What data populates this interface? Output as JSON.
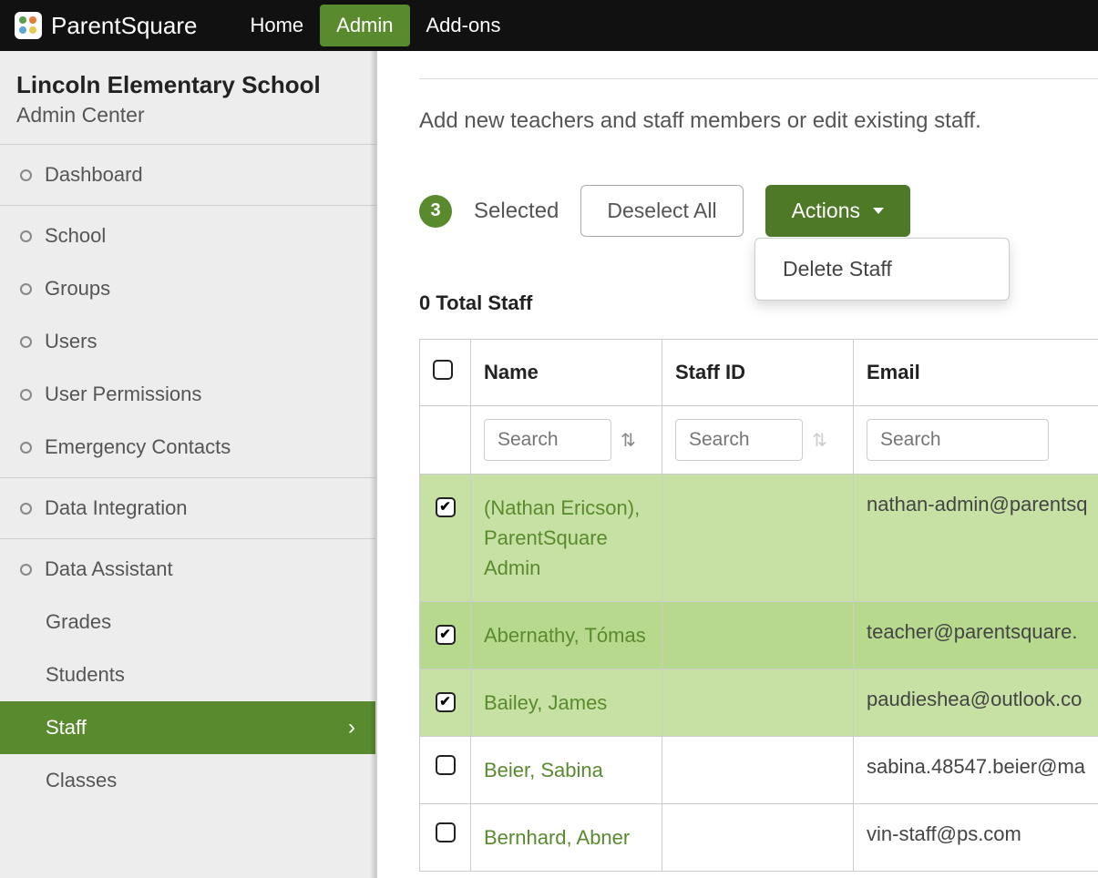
{
  "topnav": {
    "brand": "ParentSquare",
    "items": [
      "Home",
      "Admin",
      "Add-ons"
    ],
    "active_index": 1
  },
  "sidebar": {
    "school_name": "Lincoln Elementary School",
    "subtitle": "Admin Center",
    "section1": [
      "Dashboard"
    ],
    "section2": [
      "School",
      "Groups",
      "Users",
      "User Permissions",
      "Emergency Contacts"
    ],
    "section3": [
      "Data Integration"
    ],
    "section4_header": "Data Assistant",
    "section4_items": [
      "Grades",
      "Students",
      "Staff",
      "Classes"
    ],
    "active_item": "Staff"
  },
  "main": {
    "intro": "Add new teachers and staff members or edit existing staff.",
    "selected_count": "3",
    "selected_label": "Selected",
    "deselect_label": "Deselect All",
    "actions_label": "Actions",
    "actions_menu": [
      "Delete Staff"
    ],
    "total_staff_label": "0 Total Staff"
  },
  "table": {
    "columns": {
      "name": "Name",
      "staff_id": "Staff ID",
      "email": "Email"
    },
    "search_placeholder": "Search",
    "rows": [
      {
        "checked": true,
        "name": "(Nathan Ericson), ParentSquare Admin",
        "staff_id": "",
        "email": "nathan-admin@parentsq"
      },
      {
        "checked": true,
        "name": "Abernathy, Tómas",
        "staff_id": "",
        "email": "teacher@parentsquare."
      },
      {
        "checked": true,
        "name": "Bailey, James",
        "staff_id": "",
        "email": "paudieshea@outlook.co"
      },
      {
        "checked": false,
        "name": "Beier, Sabina",
        "staff_id": "",
        "email": "sabina.48547.beier@ma"
      },
      {
        "checked": false,
        "name": "Bernhard, Abner",
        "staff_id": "",
        "email": "vin-staff@ps.com"
      }
    ]
  }
}
